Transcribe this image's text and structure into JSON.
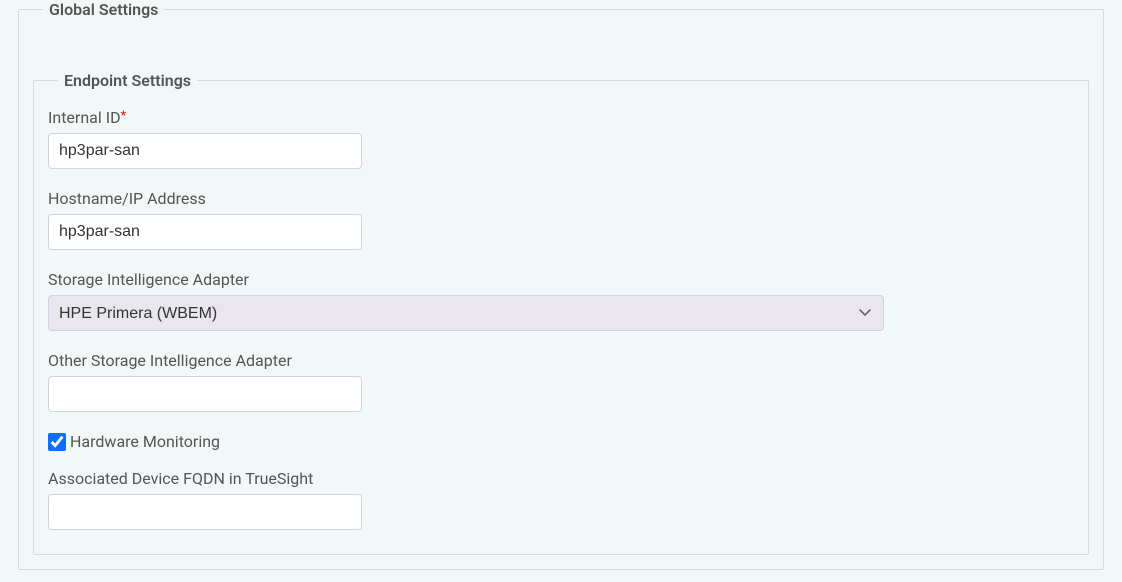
{
  "globalSettings": {
    "legend": "Global Settings"
  },
  "endpointSettings": {
    "legend": "Endpoint Settings",
    "internalId": {
      "label": "Internal ID",
      "required": true,
      "value": "hp3par-san"
    },
    "hostname": {
      "label": "Hostname/IP Address",
      "value": "hp3par-san"
    },
    "storageAdapter": {
      "label": "Storage Intelligence Adapter",
      "value": "HPE Primera (WBEM)"
    },
    "otherStorageAdapter": {
      "label": "Other Storage Intelligence Adapter",
      "value": ""
    },
    "hardwareMonitoring": {
      "label": "Hardware Monitoring",
      "checked": true
    },
    "associatedDevice": {
      "label": "Associated Device FQDN in TrueSight",
      "value": ""
    }
  }
}
